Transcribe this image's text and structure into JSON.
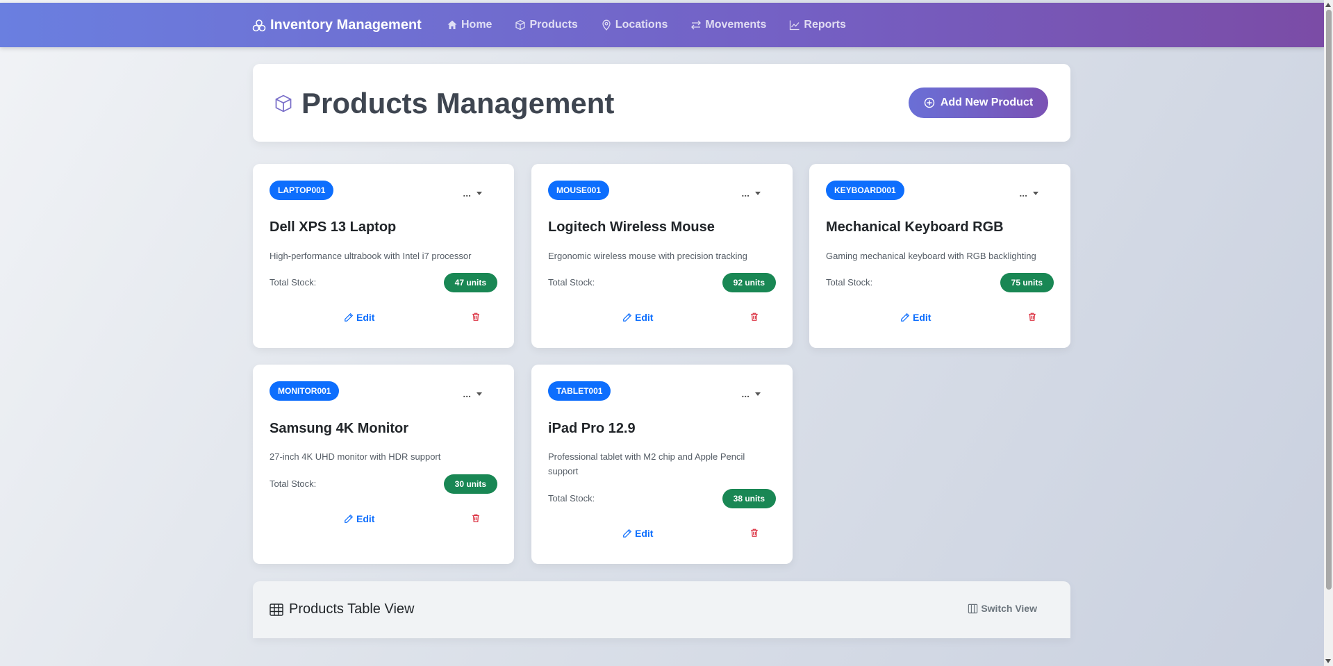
{
  "navbar": {
    "brand": "Inventory Management",
    "brand_icon": "boxes-icon",
    "items": [
      {
        "label": "Home",
        "icon": "house-icon"
      },
      {
        "label": "Products",
        "icon": "box-icon"
      },
      {
        "label": "Locations",
        "icon": "map-pin-icon"
      },
      {
        "label": "Movements",
        "icon": "arrows-exchange-icon"
      },
      {
        "label": "Reports",
        "icon": "line-chart-icon"
      }
    ]
  },
  "header": {
    "title": "Products Management",
    "add_button_label": "Add New Product"
  },
  "products": [
    {
      "sku": "LAPTOP001",
      "name": "Dell XPS 13 Laptop",
      "description": "High-performance ultrabook with Intel i7 processor",
      "stock_label": "Total Stock:",
      "stock": "47 units",
      "menu_label": "...",
      "edit_label": "Edit"
    },
    {
      "sku": "MOUSE001",
      "name": "Logitech Wireless Mouse",
      "description": "Ergonomic wireless mouse with precision tracking",
      "stock_label": "Total Stock:",
      "stock": "92 units",
      "menu_label": "...",
      "edit_label": "Edit"
    },
    {
      "sku": "KEYBOARD001",
      "name": "Mechanical Keyboard RGB",
      "description": "Gaming mechanical keyboard with RGB backlighting",
      "stock_label": "Total Stock:",
      "stock": "75 units",
      "menu_label": "...",
      "edit_label": "Edit"
    },
    {
      "sku": "MONITOR001",
      "name": "Samsung 4K Monitor",
      "description": "27-inch 4K UHD monitor with HDR support",
      "stock_label": "Total Stock:",
      "stock": "30 units",
      "menu_label": "...",
      "edit_label": "Edit"
    },
    {
      "sku": "TABLET001",
      "name": "iPad Pro 12.9",
      "description": "Professional tablet with M2 chip and Apple Pencil support",
      "stock_label": "Total Stock:",
      "stock": "38 units",
      "menu_label": "...",
      "edit_label": "Edit"
    }
  ],
  "table_section": {
    "title": "Products Table View",
    "switch_label": "Switch View"
  },
  "colors": {
    "sku_badge": "#0d6efd",
    "stock_badge": "#198754",
    "delete": "#dc3545",
    "accent_start": "#6a7fe0",
    "accent_end": "#7b4ca6"
  }
}
